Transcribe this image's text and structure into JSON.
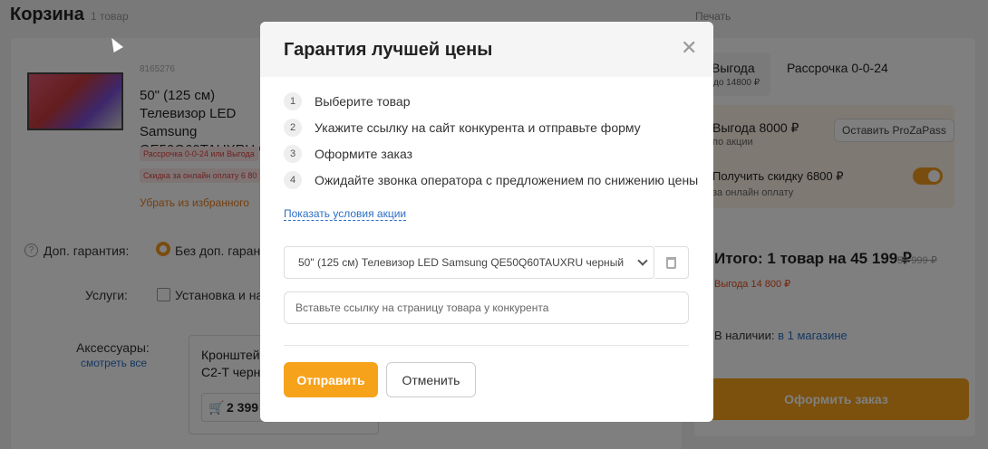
{
  "page": {
    "title": "Корзина",
    "count": "1 товар",
    "print": "Печать"
  },
  "product": {
    "code": "8165276",
    "name": "50\" (125 см) Телевизор LED Samsung QE50Q60TAUXRU ч",
    "badge_installment": "Рассрочка 0-0-24 или Выгода",
    "badge_discount": "Скидка за онлайн оплату 6 80",
    "remove_favorite": "Убрать из избранного"
  },
  "warranty": {
    "label": "Доп. гарантия:",
    "value": "Без доп. гарант"
  },
  "services": {
    "label": "Услуги:",
    "value": "Установка и на"
  },
  "accessories": {
    "label": "Аксессуары:",
    "see_all": "смотреть все",
    "item_name_1": "Кронштей",
    "item_name_2": "C2-T черн",
    "price": "2 399"
  },
  "summary": {
    "tab1_title": "Выгода",
    "tab1_sub": "до 14800 ₽",
    "tab2_title": "Рассрочка 0-0-24",
    "promo1_title": "Выгода 8000 ₽",
    "promo1_sub": "по акции",
    "propass_button": "Оставить ProZaPass",
    "promo2_title": "Получить скидку 6800 ₽",
    "promo2_sub": "за онлайн оплату",
    "total": "Итого: 1 товар на 45 199 ₽",
    "total_old": "59 999 ₽",
    "total_saving": "Выгода 14 800 ₽",
    "availability": "В наличии:",
    "availability_link": "в 1 магазине",
    "order_button": "Оформить заказ"
  },
  "modal": {
    "title": "Гарантия лучшей цены",
    "steps": [
      {
        "num": "1",
        "text": "Выберите товар"
      },
      {
        "num": "2",
        "text": "Укажите ссылку на сайт конкурента и отправьте форму"
      },
      {
        "num": "3",
        "text": "Оформите заказ"
      },
      {
        "num": "4",
        "text": "Ожидайте звонка оператора с предложением по снижению цены"
      }
    ],
    "terms_link": "Показать условия акции",
    "selected_product": "50\" (125 см) Телевизор LED Samsung QE50Q60TAUXRU черный",
    "link_placeholder": "Вставьте ссылку на страницу товара у конкурента",
    "send_button": "Отправить",
    "cancel_button": "Отменить"
  },
  "colors": {
    "accent": "#f7a21b",
    "link": "#2b6fc5"
  }
}
